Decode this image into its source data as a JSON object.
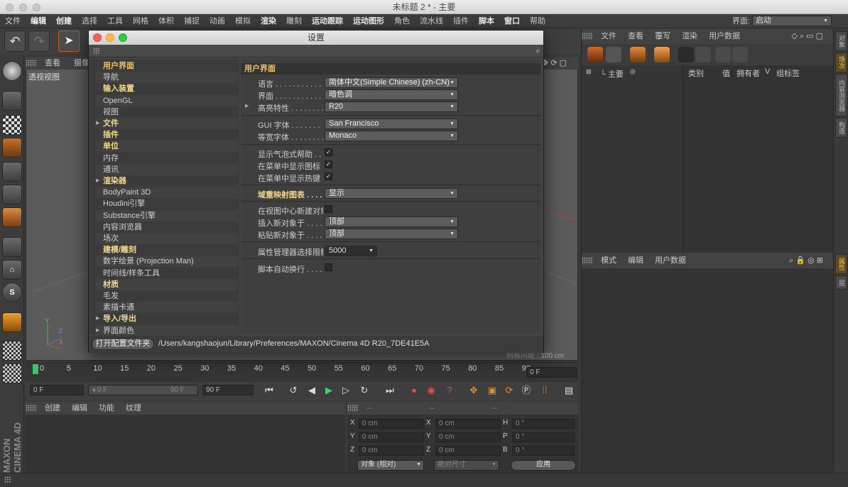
{
  "window": {
    "title": "未标题 2 * - 主要"
  },
  "menu": [
    "文件",
    "编辑",
    "创建",
    "选择",
    "工具",
    "网格",
    "体积",
    "捕捉",
    "动画",
    "模拟",
    "渲染",
    "雕刻",
    "运动跟踪",
    "运动图形",
    "角色",
    "流水线",
    "插件",
    "脚本",
    "窗口",
    "帮助"
  ],
  "layout": {
    "label": "界面:",
    "value": "启动"
  },
  "viewport": {
    "menu": [
      "查看",
      "摄像机"
    ],
    "label": "透视视图",
    "grid_spacing": "网格间距 : 100 cm"
  },
  "timeline": {
    "ticks": [
      "0",
      "5",
      "10",
      "15",
      "20",
      "25",
      "30",
      "35",
      "40",
      "45",
      "50",
      "55",
      "60",
      "65",
      "70",
      "75",
      "80",
      "85",
      "90"
    ],
    "current_frame": "0 F"
  },
  "playback": {
    "start": "0 F",
    "range_start": "0 F",
    "range_end": "90 F",
    "end": "90 F"
  },
  "material_panel": {
    "tabs": [
      "创建",
      "编辑",
      "功能",
      "纹理"
    ]
  },
  "coords": {
    "headers": [
      "--",
      "--",
      "--"
    ],
    "rows": [
      {
        "a": "X",
        "av": "0 cm",
        "b": "X",
        "bv": "0 cm",
        "c": "H",
        "cv": "0 °"
      },
      {
        "a": "Y",
        "av": "0 cm",
        "b": "Y",
        "bv": "0 cm",
        "c": "P",
        "cv": "0 °"
      },
      {
        "a": "Z",
        "av": "0 cm",
        "b": "Z",
        "bv": "0 cm",
        "c": "B",
        "cv": "0 °"
      }
    ],
    "mode": "对象 (相对)",
    "size_mode": "绝对尺寸",
    "apply": "应用"
  },
  "object_manager": {
    "menu": [
      "文件",
      "查看",
      "覆写",
      "渲染",
      "用户数据"
    ],
    "root": "主要",
    "columns": [
      "类别",
      "值",
      "拥有者",
      "V",
      "组标签"
    ]
  },
  "attribute_manager": {
    "menu": [
      "模式",
      "编辑",
      "用户数据"
    ]
  },
  "side_tabs": {
    "top": [
      "对象",
      "场次",
      "内容浏览器",
      "构造"
    ],
    "bottom": [
      "属性",
      "层"
    ]
  },
  "brand": "MAXON CINEMA 4D",
  "dialog": {
    "title": "设置",
    "categories": [
      {
        "label": "用户界面",
        "style": "sel",
        "arrow": false
      },
      {
        "label": "导航",
        "style": "",
        "arrow": false
      },
      {
        "label": "输入装置",
        "style": "bold",
        "arrow": false
      },
      {
        "label": "OpenGL",
        "style": "",
        "arrow": false
      },
      {
        "label": "视图",
        "style": "",
        "arrow": false
      },
      {
        "label": "文件",
        "style": "bold",
        "arrow": true
      },
      {
        "label": "插件",
        "style": "bold",
        "arrow": false
      },
      {
        "label": "单位",
        "style": "bold",
        "arrow": false
      },
      {
        "label": "内存",
        "style": "",
        "arrow": false
      },
      {
        "label": "通讯",
        "style": "",
        "arrow": false
      },
      {
        "label": "渲染器",
        "style": "bold",
        "arrow": true
      },
      {
        "label": "BodyPaint 3D",
        "style": "",
        "arrow": false
      },
      {
        "label": "Houdini引擎",
        "style": "",
        "arrow": false
      },
      {
        "label": "Substance引擎",
        "style": "",
        "arrow": false
      },
      {
        "label": "内容浏览器",
        "style": "",
        "arrow": false
      },
      {
        "label": "场次",
        "style": "",
        "arrow": false
      },
      {
        "label": "建模/雕刻",
        "style": "bold",
        "arrow": false
      },
      {
        "label": "数字绘景 (Projection Man)",
        "style": "",
        "arrow": false
      },
      {
        "label": "时间线/样条工具",
        "style": "",
        "arrow": false
      },
      {
        "label": "材质",
        "style": "bold",
        "arrow": false
      },
      {
        "label": "毛发",
        "style": "",
        "arrow": false
      },
      {
        "label": "素描卡通",
        "style": "",
        "arrow": false
      },
      {
        "label": "导入/导出",
        "style": "bold",
        "arrow": true
      },
      {
        "label": "界面颜色",
        "style": "",
        "arrow": true
      }
    ],
    "section": "用户界面",
    "language_label": "语言 . . . . . . . . . . . . . .",
    "language": "简体中文(Simple Chinese) (zh-CN)",
    "scheme_label": "界面 . . . . . . . . . . . . . .",
    "scheme": "暗色调",
    "highlight_label": "高亮特性 . . . . . . . . .",
    "highlight": "R20",
    "gui_font_label": "GUI 字体 . . . . . . .",
    "gui_font": "San Francisco",
    "mono_font_label": "等宽字体 . . . . . . . .",
    "mono_font": "Monaco",
    "bubble_label": "显示气泡式帮助 . . . .",
    "menu_icons_label": "在菜单中显示图标 . . .",
    "menu_hotkeys_label": "在菜单中显示热键 . . .",
    "color_map_label": "域重映射图表 . . . . . .",
    "color_map": "显示",
    "center_new_label": "在视图中心新建对象",
    "insert_label": "插入新对象于 . . . . . .",
    "insert": "顶部",
    "paste_label": "粘贴新对象于 . . . . . .",
    "paste": "顶部",
    "attr_limit_label": "属性管理器选择限制",
    "attr_limit": "5000",
    "script_wrap_label": "脚本自动换行 . . . . . .",
    "open_folder": "打开配置文件夹",
    "path": "/Users/kangshaojun/Library/Preferences/MAXON/Cinema 4D R20_7DE41E5A"
  }
}
